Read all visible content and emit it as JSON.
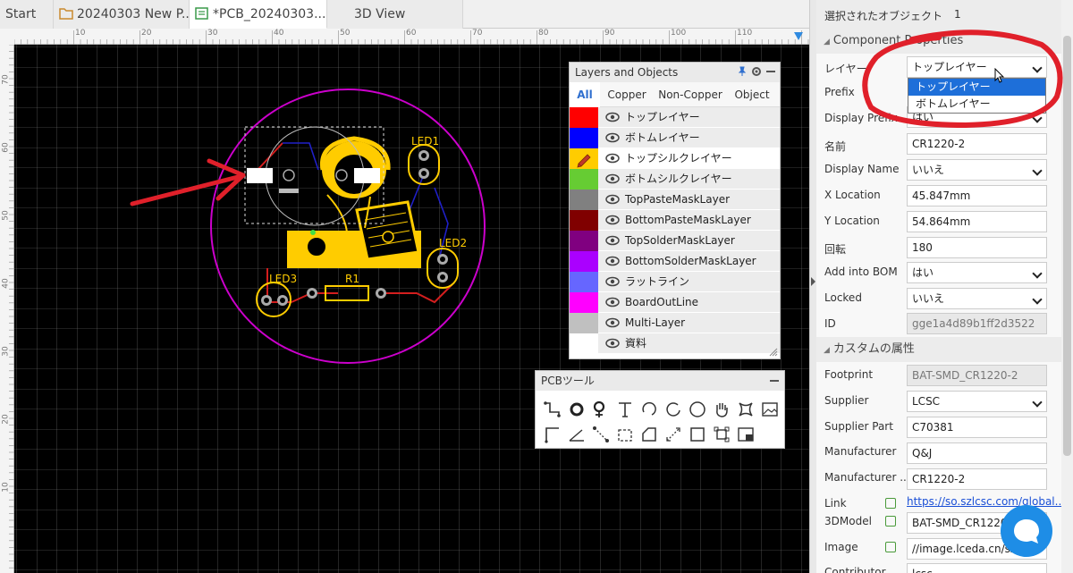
{
  "tabs": [
    {
      "label": "Start"
    },
    {
      "label": "20240303 New P..."
    },
    {
      "label": "*PCB_20240303..."
    },
    {
      "label": "3D View"
    }
  ],
  "ruler_top": [
    "10",
    "20",
    "30",
    "40",
    "50",
    "60",
    "70",
    "80",
    "90",
    "100",
    "110"
  ],
  "ruler_left": [
    "70",
    "60",
    "50",
    "40",
    "30",
    "20",
    "10"
  ],
  "pcb_labels": {
    "led1": "LED1",
    "led2": "LED2",
    "led3": "LED3",
    "r1": "R1"
  },
  "layers_panel": {
    "title": "Layers and Objects",
    "tabs": [
      "All",
      "Copper",
      "Non-Copper",
      "Object"
    ],
    "layers": [
      {
        "name": "トップレイヤー",
        "color": "#ff0000"
      },
      {
        "name": "ボトムレイヤー",
        "color": "#0000ff"
      },
      {
        "name": "トップシルクレイヤー",
        "color": "#ffcc00"
      },
      {
        "name": "ボトムシルクレイヤー",
        "color": "#66cc33"
      },
      {
        "name": "TopPasteMaskLayer",
        "color": "#808080"
      },
      {
        "name": "BottomPasteMaskLayer",
        "color": "#800000"
      },
      {
        "name": "TopSolderMaskLayer",
        "color": "#800080"
      },
      {
        "name": "BottomSolderMaskLayer",
        "color": "#aa00ff"
      },
      {
        "name": "ラットライン",
        "color": "#6666ff"
      },
      {
        "name": "BoardOutLine",
        "color": "#ff00ff"
      },
      {
        "name": "Multi-Layer",
        "color": "#c0c0c0"
      },
      {
        "name": "資料",
        "color": "#ffffff"
      }
    ]
  },
  "pcb_tools": {
    "title": "PCBツール"
  },
  "properties": {
    "selected_label": "選択されたオブジェクト",
    "selected_count": "1",
    "section_component": "Component Properties",
    "section_custom": "カスタムの属性",
    "layer_label": "レイヤー",
    "layer_value": "トップレイヤー",
    "layer_options": [
      "トップレイヤー",
      "ボトムレイヤー"
    ],
    "prefix_label": "Prefix",
    "display_prefix_label": "Display Prefix",
    "display_prefix_value": "はい",
    "name_label": "名前",
    "name_value": "CR1220-2",
    "display_name_label": "Display Name",
    "display_name_value": "いいえ",
    "x_label": "X Location",
    "x_value": "45.847mm",
    "y_label": "Y Location",
    "y_value": "54.864mm",
    "rotation_label": "回転",
    "rotation_value": "180",
    "bom_label": "Add into BOM",
    "bom_value": "はい",
    "locked_label": "Locked",
    "locked_value": "いいえ",
    "id_label": "ID",
    "id_value": "gge1a4d89b1ff2d3522",
    "footprint_label": "Footprint",
    "footprint_value": "BAT-SMD_CR1220-2",
    "supplier_label": "Supplier",
    "supplier_value": "LCSC",
    "supplier_part_label": "Supplier Part",
    "supplier_part_value": "C70381",
    "manufacturer_label": "Manufacturer",
    "manufacturer_value": "Q&J",
    "manufacturer_part_label": "Manufacturer ...",
    "manufacturer_part_value": "CR1220-2",
    "link_label": "Link",
    "link_value": "https://so.szlcsc.com/global...",
    "model_label": "3DModel",
    "model_value": "BAT-SMD_CR1220-...",
    "image_label": "Image",
    "image_value": "//image.lceda.cn/szlcs...",
    "contributor_label": "Contributor",
    "contributor_value": "lcsc"
  },
  "colors": {
    "accent": "#2f6fcf",
    "silk": "#ffcc00",
    "outline": "#cc00cc",
    "annotation": "#e0202a"
  }
}
